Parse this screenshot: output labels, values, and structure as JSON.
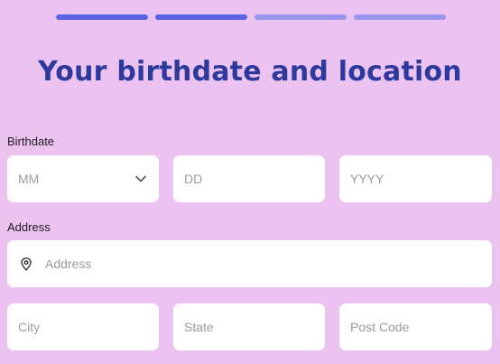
{
  "progress": {
    "steps_total": 4,
    "steps_completed": 2
  },
  "title": "Your birthdate and location",
  "birthdate": {
    "label": "Birthdate",
    "month_placeholder": "MM",
    "day_placeholder": "DD",
    "year_placeholder": "YYYY"
  },
  "address": {
    "label": "Address",
    "address_placeholder": "Address",
    "city_placeholder": "City",
    "state_placeholder": "State",
    "postcode_placeholder": "Post Code"
  },
  "icons": {
    "month_dropdown": "chevron-down-icon",
    "address_field": "location-pin-icon"
  },
  "colors": {
    "background": "#ecc3f0",
    "progress_active": "#5a63e6",
    "progress_inactive": "#9a95ee",
    "title": "#2b3a9c"
  }
}
